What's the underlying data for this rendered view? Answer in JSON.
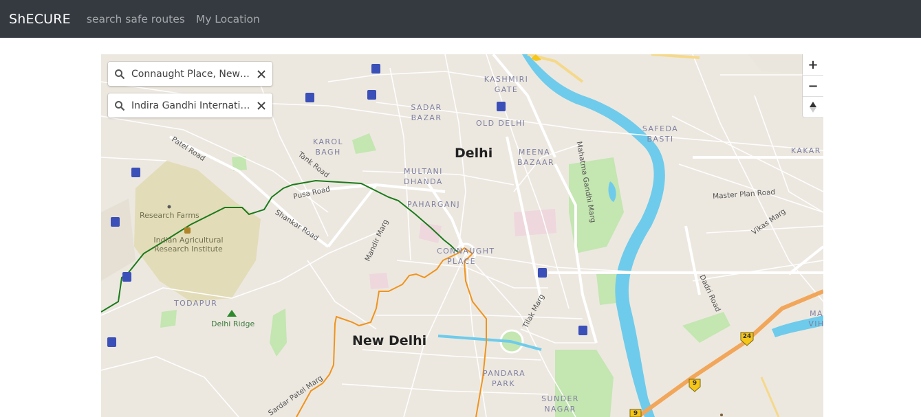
{
  "navbar": {
    "brand": "ShECURE",
    "links": [
      "search safe routes",
      "My Location"
    ]
  },
  "directions": {
    "origin_value": "Connaught Place, New Delhi, Delhi",
    "destination_value": "Indira Gandhi International Airport"
  },
  "zoom_controls": {
    "zoom_in": "+",
    "zoom_out": "−",
    "compass": "▲"
  },
  "map_labels": {
    "city_main": "Delhi",
    "city_new": "New Delhi",
    "kashmiri_gate": "KASHMIRI GATE",
    "sadar_bazar": "SADAR BAZAR",
    "old_delhi": "OLD DELHI",
    "safeda_basti": "SAFEDA BASTI",
    "karol_bagh": "KAROL BAGH",
    "meena_bazaar": "MEENA BAZAAR",
    "multani_dhanda": "MULTANI DHANDA",
    "paharganj": "PAHARGANJ",
    "connaught_place": "CONNAUGHT PLACE",
    "todapur": "TODAPUR",
    "pandara_park": "PANDARA PARK",
    "sunder_nagar": "SUNDER NAGAR",
    "kakar": "KAKAR",
    "mavih": "MA VIH",
    "research_farms": "Research Farms",
    "iari": "Indian Agricultural Research Institute",
    "delhi_ridge": "Delhi Ridge",
    "patel_road": "Patel Road",
    "tank_road": "Tank Road",
    "pusa_road": "Pusa Road",
    "shankar_road": "Shankar Road",
    "mandir_marg": "Mandir Marg",
    "mahatma_gandhi_marg": "Mahatma Gandhi Marg",
    "master_plan_road": "Master Plan Road",
    "vikas_marg": "Vikas Marg",
    "tilak_marg": "Tilak Marg",
    "dadri_road": "Dadri Road",
    "sardar_patel_marg": "Sardar Patel Marg",
    "shield_24": "24",
    "shield_9a": "9",
    "shield_9b": "9"
  },
  "colors": {
    "navbar_bg": "#343a40",
    "route_safe": "#1a7a1a",
    "route_alt": "#f0931c",
    "river": "#6ecbeb",
    "park": "#c4e6b1",
    "highway": "#f2a65a"
  }
}
